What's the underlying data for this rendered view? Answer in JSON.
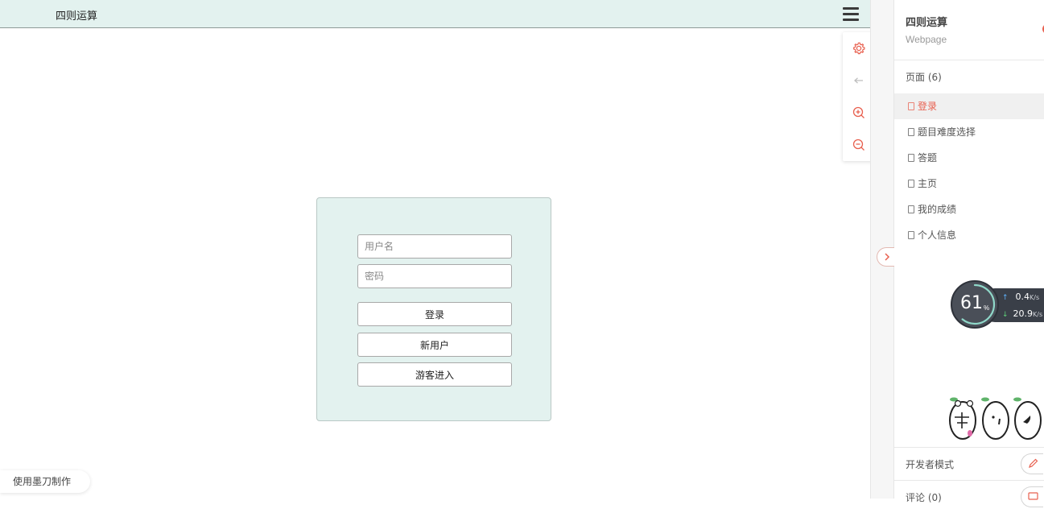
{
  "prototype": {
    "title": "四则运算",
    "login": {
      "username_placeholder": "用户名",
      "password_placeholder": "密码",
      "login_label": "登录",
      "new_user_label": "新用户",
      "guest_label": "游客进入"
    },
    "made_with": "使用墨刀制作"
  },
  "sidebar": {
    "project_title": "四则运算",
    "project_type": "Webpage",
    "pages_header": "页面 (6)",
    "pages": [
      {
        "label": "登录",
        "active": true
      },
      {
        "label": "题目难度选择"
      },
      {
        "label": "答题"
      },
      {
        "label": "主页"
      },
      {
        "label": "我的成绩"
      },
      {
        "label": "个人信息"
      }
    ],
    "developer_mode": "开发者模式",
    "comments": "评论 (0)"
  },
  "speed_widget": {
    "percent": "61",
    "percent_symbol": "%",
    "upload": "0.4",
    "download": "20.9",
    "unit": "K/s",
    "usage_fraction": 0.61
  },
  "colors": {
    "header_bg": "#e3f2ef",
    "accent": "#e8604f",
    "card_bg": "#e3f2ef"
  },
  "icons": {
    "tools": [
      "gear-icon",
      "back-arrow-icon",
      "zoom-in-icon",
      "zoom-out-icon"
    ],
    "menu": "hamburger-menu-icon",
    "collapse": "chevron-right-icon",
    "developer": "pencil-icon",
    "comments": "comment-icon"
  }
}
